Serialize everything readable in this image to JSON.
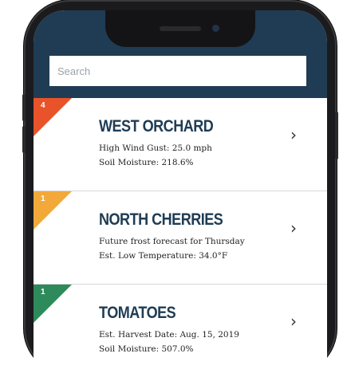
{
  "search": {
    "placeholder": "Search"
  },
  "cards": [
    {
      "badge": "4",
      "badge_color": "#e8532a",
      "title": "WEST ORCHARD",
      "line1": "High Wind Gust: 25.0 mph",
      "line2": "Soil Moisture: 218.6%",
      "chevron_icon": "chevron-right-icon"
    },
    {
      "badge": "1",
      "badge_color": "#f2a93a",
      "title": "NORTH CHERRIES",
      "line1": "Future frost forecast for Thursday",
      "line2": "Est. Low Temperature: 34.0°F",
      "chevron_icon": "chevron-right-icon"
    },
    {
      "badge": "1",
      "badge_color": "#2d8a5a",
      "title": "TOMATOES",
      "line1": "Est. Harvest Date: Aug. 15, 2019",
      "line2": "Soil Moisture: 507.0%",
      "chevron_icon": "chevron-right-icon"
    }
  ],
  "colors": {
    "header": "#1f3c54",
    "title_text": "#1f3c54",
    "phone_body": "#1b1b1d"
  }
}
